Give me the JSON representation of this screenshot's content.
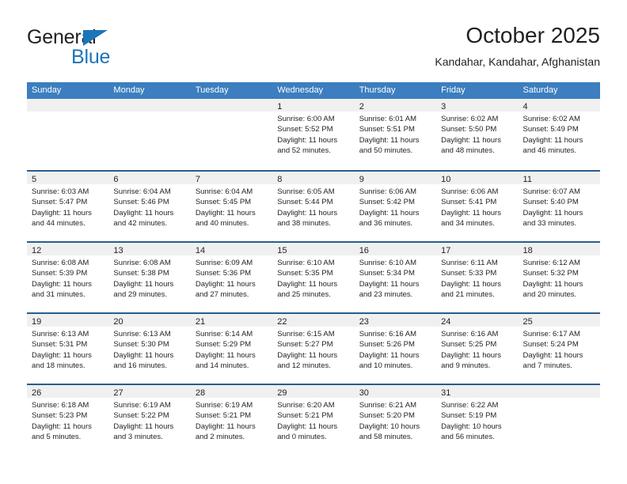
{
  "brand": {
    "name_part1": "General",
    "name_part2": "Blue",
    "triangle_color": "#1b75bb"
  },
  "header": {
    "title": "October 2025",
    "subtitle": "Kandahar, Kandahar, Afghanistan"
  },
  "theme": {
    "header_blue": "#3c7ebf",
    "row_separator": "#2a5d8f",
    "daynum_band": "#f0f0f0",
    "text": "#231f20"
  },
  "weekdays": [
    "Sunday",
    "Monday",
    "Tuesday",
    "Wednesday",
    "Thursday",
    "Friday",
    "Saturday"
  ],
  "labels": {
    "sunrise_prefix": "Sunrise:",
    "sunset_prefix": "Sunset:",
    "daylight_prefix": "Daylight:"
  },
  "weeks": [
    [
      {
        "day": "",
        "sunrise": "",
        "sunset": "",
        "daylight1": "",
        "daylight2": ""
      },
      {
        "day": "",
        "sunrise": "",
        "sunset": "",
        "daylight1": "",
        "daylight2": ""
      },
      {
        "day": "",
        "sunrise": "",
        "sunset": "",
        "daylight1": "",
        "daylight2": ""
      },
      {
        "day": "1",
        "sunrise": "Sunrise: 6:00 AM",
        "sunset": "Sunset: 5:52 PM",
        "daylight1": "Daylight: 11 hours",
        "daylight2": "and 52 minutes."
      },
      {
        "day": "2",
        "sunrise": "Sunrise: 6:01 AM",
        "sunset": "Sunset: 5:51 PM",
        "daylight1": "Daylight: 11 hours",
        "daylight2": "and 50 minutes."
      },
      {
        "day": "3",
        "sunrise": "Sunrise: 6:02 AM",
        "sunset": "Sunset: 5:50 PM",
        "daylight1": "Daylight: 11 hours",
        "daylight2": "and 48 minutes."
      },
      {
        "day": "4",
        "sunrise": "Sunrise: 6:02 AM",
        "sunset": "Sunset: 5:49 PM",
        "daylight1": "Daylight: 11 hours",
        "daylight2": "and 46 minutes."
      }
    ],
    [
      {
        "day": "5",
        "sunrise": "Sunrise: 6:03 AM",
        "sunset": "Sunset: 5:47 PM",
        "daylight1": "Daylight: 11 hours",
        "daylight2": "and 44 minutes."
      },
      {
        "day": "6",
        "sunrise": "Sunrise: 6:04 AM",
        "sunset": "Sunset: 5:46 PM",
        "daylight1": "Daylight: 11 hours",
        "daylight2": "and 42 minutes."
      },
      {
        "day": "7",
        "sunrise": "Sunrise: 6:04 AM",
        "sunset": "Sunset: 5:45 PM",
        "daylight1": "Daylight: 11 hours",
        "daylight2": "and 40 minutes."
      },
      {
        "day": "8",
        "sunrise": "Sunrise: 6:05 AM",
        "sunset": "Sunset: 5:44 PM",
        "daylight1": "Daylight: 11 hours",
        "daylight2": "and 38 minutes."
      },
      {
        "day": "9",
        "sunrise": "Sunrise: 6:06 AM",
        "sunset": "Sunset: 5:42 PM",
        "daylight1": "Daylight: 11 hours",
        "daylight2": "and 36 minutes."
      },
      {
        "day": "10",
        "sunrise": "Sunrise: 6:06 AM",
        "sunset": "Sunset: 5:41 PM",
        "daylight1": "Daylight: 11 hours",
        "daylight2": "and 34 minutes."
      },
      {
        "day": "11",
        "sunrise": "Sunrise: 6:07 AM",
        "sunset": "Sunset: 5:40 PM",
        "daylight1": "Daylight: 11 hours",
        "daylight2": "and 33 minutes."
      }
    ],
    [
      {
        "day": "12",
        "sunrise": "Sunrise: 6:08 AM",
        "sunset": "Sunset: 5:39 PM",
        "daylight1": "Daylight: 11 hours",
        "daylight2": "and 31 minutes."
      },
      {
        "day": "13",
        "sunrise": "Sunrise: 6:08 AM",
        "sunset": "Sunset: 5:38 PM",
        "daylight1": "Daylight: 11 hours",
        "daylight2": "and 29 minutes."
      },
      {
        "day": "14",
        "sunrise": "Sunrise: 6:09 AM",
        "sunset": "Sunset: 5:36 PM",
        "daylight1": "Daylight: 11 hours",
        "daylight2": "and 27 minutes."
      },
      {
        "day": "15",
        "sunrise": "Sunrise: 6:10 AM",
        "sunset": "Sunset: 5:35 PM",
        "daylight1": "Daylight: 11 hours",
        "daylight2": "and 25 minutes."
      },
      {
        "day": "16",
        "sunrise": "Sunrise: 6:10 AM",
        "sunset": "Sunset: 5:34 PM",
        "daylight1": "Daylight: 11 hours",
        "daylight2": "and 23 minutes."
      },
      {
        "day": "17",
        "sunrise": "Sunrise: 6:11 AM",
        "sunset": "Sunset: 5:33 PM",
        "daylight1": "Daylight: 11 hours",
        "daylight2": "and 21 minutes."
      },
      {
        "day": "18",
        "sunrise": "Sunrise: 6:12 AM",
        "sunset": "Sunset: 5:32 PM",
        "daylight1": "Daylight: 11 hours",
        "daylight2": "and 20 minutes."
      }
    ],
    [
      {
        "day": "19",
        "sunrise": "Sunrise: 6:13 AM",
        "sunset": "Sunset: 5:31 PM",
        "daylight1": "Daylight: 11 hours",
        "daylight2": "and 18 minutes."
      },
      {
        "day": "20",
        "sunrise": "Sunrise: 6:13 AM",
        "sunset": "Sunset: 5:30 PM",
        "daylight1": "Daylight: 11 hours",
        "daylight2": "and 16 minutes."
      },
      {
        "day": "21",
        "sunrise": "Sunrise: 6:14 AM",
        "sunset": "Sunset: 5:29 PM",
        "daylight1": "Daylight: 11 hours",
        "daylight2": "and 14 minutes."
      },
      {
        "day": "22",
        "sunrise": "Sunrise: 6:15 AM",
        "sunset": "Sunset: 5:27 PM",
        "daylight1": "Daylight: 11 hours",
        "daylight2": "and 12 minutes."
      },
      {
        "day": "23",
        "sunrise": "Sunrise: 6:16 AM",
        "sunset": "Sunset: 5:26 PM",
        "daylight1": "Daylight: 11 hours",
        "daylight2": "and 10 minutes."
      },
      {
        "day": "24",
        "sunrise": "Sunrise: 6:16 AM",
        "sunset": "Sunset: 5:25 PM",
        "daylight1": "Daylight: 11 hours",
        "daylight2": "and 9 minutes."
      },
      {
        "day": "25",
        "sunrise": "Sunrise: 6:17 AM",
        "sunset": "Sunset: 5:24 PM",
        "daylight1": "Daylight: 11 hours",
        "daylight2": "and 7 minutes."
      }
    ],
    [
      {
        "day": "26",
        "sunrise": "Sunrise: 6:18 AM",
        "sunset": "Sunset: 5:23 PM",
        "daylight1": "Daylight: 11 hours",
        "daylight2": "and 5 minutes."
      },
      {
        "day": "27",
        "sunrise": "Sunrise: 6:19 AM",
        "sunset": "Sunset: 5:22 PM",
        "daylight1": "Daylight: 11 hours",
        "daylight2": "and 3 minutes."
      },
      {
        "day": "28",
        "sunrise": "Sunrise: 6:19 AM",
        "sunset": "Sunset: 5:21 PM",
        "daylight1": "Daylight: 11 hours",
        "daylight2": "and 2 minutes."
      },
      {
        "day": "29",
        "sunrise": "Sunrise: 6:20 AM",
        "sunset": "Sunset: 5:21 PM",
        "daylight1": "Daylight: 11 hours",
        "daylight2": "and 0 minutes."
      },
      {
        "day": "30",
        "sunrise": "Sunrise: 6:21 AM",
        "sunset": "Sunset: 5:20 PM",
        "daylight1": "Daylight: 10 hours",
        "daylight2": "and 58 minutes."
      },
      {
        "day": "31",
        "sunrise": "Sunrise: 6:22 AM",
        "sunset": "Sunset: 5:19 PM",
        "daylight1": "Daylight: 10 hours",
        "daylight2": "and 56 minutes."
      },
      {
        "day": "",
        "sunrise": "",
        "sunset": "",
        "daylight1": "",
        "daylight2": ""
      }
    ]
  ]
}
